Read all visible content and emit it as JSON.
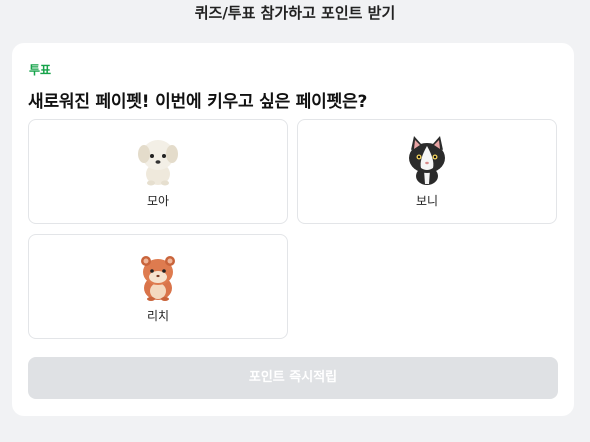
{
  "header": {
    "title": "퀴즈/투표 참가하고 포인트 받기"
  },
  "vote": {
    "tag": "투표",
    "question": "새로워진 페이펫! 이번에 키우고 싶은 페이펫은?",
    "options": [
      {
        "label": "모아",
        "icon": "white-puppy-icon"
      },
      {
        "label": "보니",
        "icon": "tuxedo-cat-icon"
      },
      {
        "label": "리치",
        "icon": "orange-hamster-icon"
      }
    ]
  },
  "submit": {
    "label": "포인트 즉시적립",
    "disabled": true
  }
}
